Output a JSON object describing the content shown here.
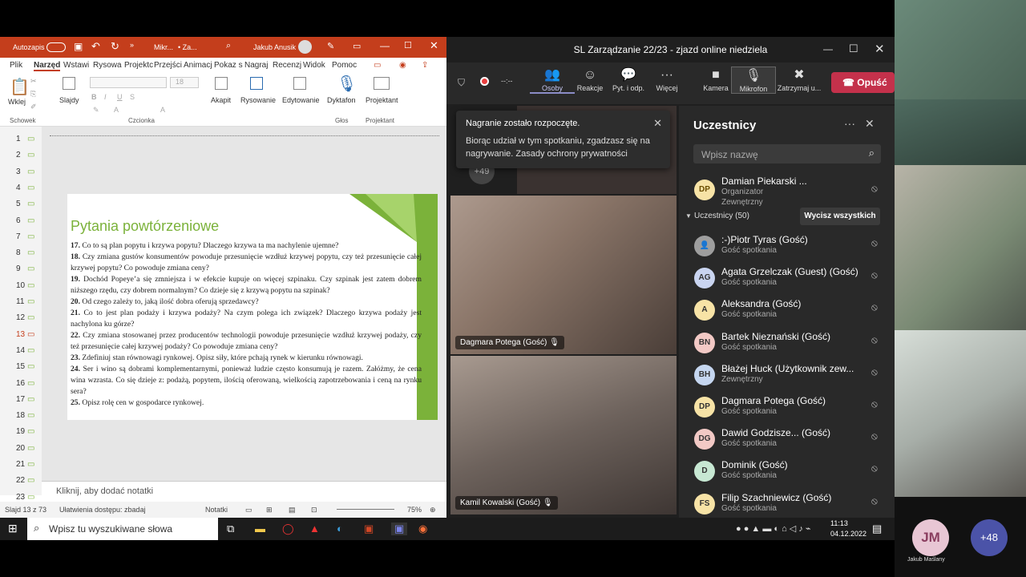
{
  "powerpoint": {
    "autosave_label": "Autozapis",
    "file_name": "Mikr...",
    "file_suffix": "• Za...",
    "user_name": "Jakub Anusik",
    "menu": [
      "Plik",
      "Narzęd",
      "Wstawi",
      "Rysowa",
      "Projektc",
      "Przejści",
      "Animacj",
      "Pokaz s",
      "Nagraj",
      "Recenzj",
      "Widok",
      "Pomoc"
    ],
    "ribbon": {
      "paste": "Wklej",
      "slides": "Slajdy",
      "font_size": "18",
      "paragraph": "Akapit",
      "drawing": "Rysowanie",
      "editing": "Edytowanie",
      "dictate": "Dyktafon",
      "designer": "Projektant",
      "groups": [
        "Schowek",
        "Czcionka",
        "Głos",
        "Projektant"
      ]
    },
    "slide_numbers": [
      "1",
      "2",
      "3",
      "4",
      "5",
      "6",
      "7",
      "8",
      "9",
      "10",
      "11",
      "12",
      "13",
      "14",
      "15",
      "16",
      "17",
      "18",
      "19",
      "20",
      "21",
      "22",
      "23"
    ],
    "slide": {
      "title": "Pytania powtórzeniowe",
      "questions": [
        {
          "num": "17.",
          "text": " Co to są plan popytu i krzywa popytu? Dlaczego krzywa ta ma nachylenie ujemne?"
        },
        {
          "num": "18.",
          "text": " Czy zmiana gustów konsumentów powoduje przesunięcie wzdłuż krzywej popytu, czy też przesunięcie całej krzywej popytu? Co powoduje zmiana ceny?"
        },
        {
          "num": "19.",
          "text": " Dochód Popeye’a się zmniejsza i w efekcie kupuje on więcej szpinaku. Czy szpinak jest zatem dobrem niższego rzędu, czy dobrem normalnym? Co dzieje się z krzywą popytu na szpinak?"
        },
        {
          "num": "20.",
          "text": " Od czego zależy to, jaką ilość dobra oferują sprzedawcy?"
        },
        {
          "num": "21.",
          "text": " Co to jest plan podaży i krzywa podaży? Na czym polega ich związek? Dlaczego krzywa podaży jest nachylona ku górze?"
        },
        {
          "num": "22.",
          "text": " Czy zmiana stosowanej przez producentów technologii powoduje przesunięcie wzdłuż krzywej podaży, czy też przesunięcie całej krzywej podaży? Co powoduje zmiana ceny?"
        },
        {
          "num": "23.",
          "text": " Zdefiniuj stan równowagi rynkowej. Opisz siły, które pchają rynek w kierunku równowagi."
        },
        {
          "num": "24.",
          "text": " Ser i wino są dobrami komplementarnymi, ponieważ ludzie często konsumują je razem. Załóżmy, że cena wina wzrasta. Co się dzieje z: podażą, popytem, ilością oferowaną, wielkością zapotrzebowania i ceną na rynku sera?"
        },
        {
          "num": "25.",
          "text": " Opisz rolę cen w gospodarce rynkowej."
        }
      ]
    },
    "notes_placeholder": "Kliknij, aby dodać notatki",
    "status": {
      "slide_info": "Slajd 13 z 73",
      "accessibility": "Ułatwienia dostępu: zbadaj",
      "notes": "Notatki",
      "zoom": "75%"
    }
  },
  "teams": {
    "window_title": "SL Zarządzanie 22/23 - zjazd online niedziela",
    "timer": "--:--",
    "toolbar": [
      "Osoby",
      "Reakcje",
      "Pyt. i odp.",
      "Więcej",
      "Kamera",
      "Mikrofon",
      "Zatrzymaj u..."
    ],
    "leave": "Opuść",
    "toast": {
      "title": "Nagranie zostało rozpoczęte.",
      "body": "Biorąc udział w tym spotkaniu, zgadzasz się na nagrywanie. Zasady ochrony prywatności"
    },
    "more_count": "+49",
    "videos": [
      "Dagmara Potega (Gość)",
      "Kamil Kowalski (Gość)"
    ],
    "panel": {
      "title": "Uczestnicy",
      "search_placeholder": "Wpisz nazwę",
      "organizer": {
        "initials": "DP",
        "name": "Damian Piekarski ...",
        "role": "Organizator",
        "role2": "Zewnętrzny"
      },
      "section": "Uczestnicy (50)",
      "mute_all": "Wycisz wszystkich",
      "participants": [
        {
          "initials": "",
          "name": ":-)Piotr Tyras (Gość)",
          "role": "Gość spotkania",
          "color": "#9e9e9e"
        },
        {
          "initials": "AG",
          "name": "Agata Grzelczak (Guest) (Gość)",
          "role": "Gość spotkania",
          "color": "#c9d4f0"
        },
        {
          "initials": "A",
          "name": "Aleksandra (Gość)",
          "role": "Gość spotkania",
          "color": "#f7e3a6"
        },
        {
          "initials": "BN",
          "name": "Bartek Nieznański (Gość)",
          "role": "Gość spotkania",
          "color": "#f2c9c5"
        },
        {
          "initials": "BH",
          "name": "Błażej Huck (Użytkownik zew...",
          "role": "Zewnętrzny",
          "color": "#c5d6f0"
        },
        {
          "initials": "DP",
          "name": "Dagmara Potega (Gość)",
          "role": "Gość spotkania",
          "color": "#f7e3a6"
        },
        {
          "initials": "DG",
          "name": "Dawid Godzisze... (Gość)",
          "role": "Gość spotkania",
          "color": "#f2c9c5"
        },
        {
          "initials": "D",
          "name": "Dominik (Gość)",
          "role": "Gość spotkania",
          "color": "#c7e8d3"
        },
        {
          "initials": "FS",
          "name": "Filip Szachniewicz (Gość)",
          "role": "Gość spotkania",
          "color": "#f7e3a6"
        }
      ]
    }
  },
  "gallery": {
    "jm_initials": "JM",
    "jm_name": "Jakub Maślany",
    "more": "+48"
  },
  "taskbar": {
    "search_placeholder": "Wpisz tu wyszukiwane słowa",
    "time": "11:13",
    "date": "04.12.2022"
  }
}
